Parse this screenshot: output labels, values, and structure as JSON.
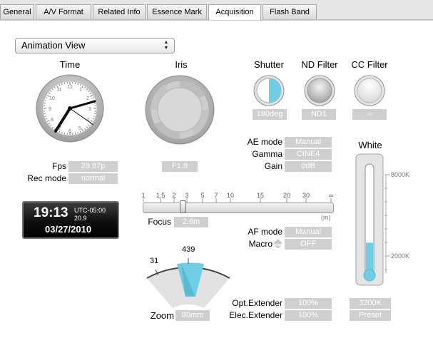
{
  "tabs": [
    {
      "label": "General"
    },
    {
      "label": "A/V Format"
    },
    {
      "label": "Related Info"
    },
    {
      "label": "Essence Mark"
    },
    {
      "label": "Acquisition"
    },
    {
      "label": "Flash Band"
    }
  ],
  "view_select": {
    "value": "Animation View"
  },
  "time": {
    "label": "Time"
  },
  "iris": {
    "label": "Iris",
    "value": "F1.9"
  },
  "shutter": {
    "label": "Shutter",
    "value": "180deg"
  },
  "nd_filter": {
    "label": "ND Filter",
    "value": "ND1"
  },
  "cc_filter": {
    "label": "CC Filter",
    "value": "--"
  },
  "fps": {
    "label": "Fps",
    "value": "29.97p"
  },
  "rec_mode": {
    "label": "Rec mode",
    "value": "normal"
  },
  "timecode": {
    "time": "19:13",
    "utc": "UTC-05:00",
    "seconds": "20.9",
    "date": "03/27/2010"
  },
  "ae_mode": {
    "label": "AE mode",
    "value": "Manual"
  },
  "gamma": {
    "label": "Gamma",
    "value": "CINE4"
  },
  "gain": {
    "label": "Gain",
    "value": "0dB"
  },
  "white": {
    "label": "White",
    "tick_high": "8000K",
    "tick_low": "2000K",
    "value": "3200K",
    "mode": "Preset",
    "level": 0.29
  },
  "focus": {
    "label": "Focus",
    "value": "2.6m",
    "scale": [
      "1",
      "1.5",
      "2",
      "3",
      "5",
      "7",
      "10",
      "15",
      "20",
      "30",
      "∞"
    ],
    "unit": "(m)"
  },
  "af_mode": {
    "label": "AF mode",
    "value": "Manual"
  },
  "macro": {
    "label": "Macro",
    "value": "OFF"
  },
  "zoom": {
    "label": "Zoom",
    "value": "80mm",
    "min_label": "31",
    "max_label": "439"
  },
  "opt_extender": {
    "label": "Opt.Extender",
    "value": "100%"
  },
  "elec_extender": {
    "label": "Elec.Extender",
    "value": "100%"
  }
}
